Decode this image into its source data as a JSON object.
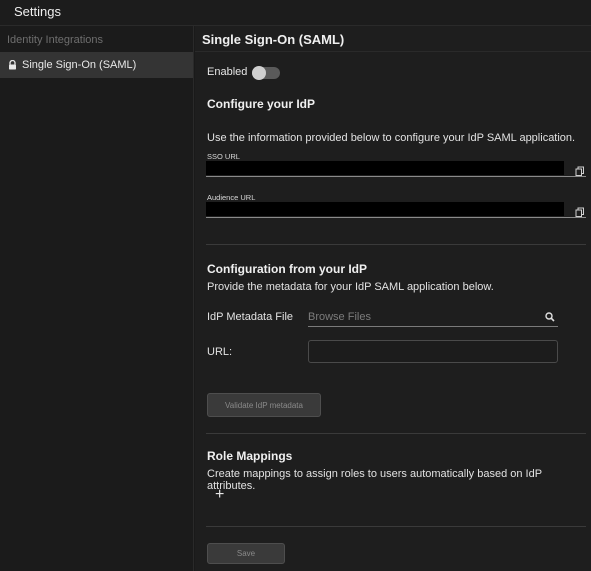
{
  "topbar": {
    "title": "Settings"
  },
  "sidebar": {
    "section_label": "Identity Integrations",
    "items": [
      {
        "label": "Single Sign-On (SAML)",
        "icon": "lock-icon",
        "selected": true
      }
    ]
  },
  "main": {
    "page_title": "Single Sign-On (SAML)",
    "enabled_label": "Enabled",
    "enabled": false,
    "configure_idp": {
      "heading": "Configure your IdP",
      "description": "Use the information provided below to configure your IdP SAML application.",
      "sso_url_label": "SSO URL",
      "audience_url_label": "Audience URL"
    },
    "config_from_idp": {
      "heading": "Configuration from your IdP",
      "description": "Provide the metadata for your IdP SAML application below.",
      "metadata_file_label": "IdP Metadata File",
      "browse_placeholder": "Browse Files",
      "url_label": "URL:",
      "url_value": "",
      "validate_button": "Validate IdP metadata"
    },
    "role_mappings": {
      "heading": "Role Mappings",
      "description": "Create mappings to assign roles to users automatically based on IdP attributes.",
      "add_symbol": "+"
    },
    "save_button": "Save"
  },
  "colors": {
    "background": "#1e1e1e",
    "sidebar_selected": "#343434",
    "toggle_off": "#5a5a5a"
  }
}
